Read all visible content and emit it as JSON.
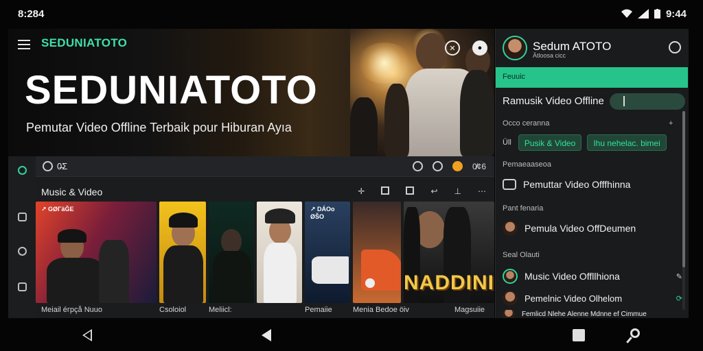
{
  "status": {
    "time_left": "8:284",
    "time_right": "9:44"
  },
  "hero": {
    "brand": "SEDUNIATOTO",
    "title": "SEDUNIATOTO",
    "subtitle": "Pemutar Video Offline Terbaik pour Hiburan Ayıa"
  },
  "content_bar": {
    "left_text": "0̶Σ",
    "right_text": "0̸¢6"
  },
  "section": {
    "title": "Music & Video"
  },
  "tiles": [
    {
      "badge": "↗ GØΓäĞE",
      "caption": "Meiail éгpçå Nuuo"
    },
    {
      "badge": "",
      "caption": "Csoloiol"
    },
    {
      "badge": "",
      "caption": "Meliicl:"
    },
    {
      "badge": "",
      "caption": ""
    },
    {
      "badge": "↗ DÁOo ØŠO",
      "caption": "Pemaiie"
    },
    {
      "badge": "",
      "caption": "Menia Bedoe öiv"
    },
    {
      "badge": "",
      "caption": "Magsuiie"
    }
  ],
  "tile_overlay": "NADDINIP",
  "right_panel": {
    "name": "Sedum ATOTO",
    "sub": "Ätloosa cicc",
    "green_bar": "Feuuic",
    "search_label": "Ramusik Video Offline",
    "label_1": "Occo ceranna",
    "chips": [
      "Pusik & Video",
      "Ihu nehelac. bimei"
    ],
    "chip_icon": "Üll",
    "label_2": "Pemaeaaseoa",
    "row_1": "Pemuttar Video Offfhinna",
    "label_3": "Pant fenaria",
    "row_2": "Pemula Video OffDeumen",
    "label_4": "Seal Olauti",
    "row_3": "Music Video Offllhiona",
    "row_4": "Pemelnic Video Olhelom",
    "row_5": "Femlicd Nlehe Alenne Mdnne ef Cimmue"
  },
  "colors": {
    "accent": "#26c48a",
    "brand": "#3fe0a8",
    "background": "#1b1c1e"
  }
}
